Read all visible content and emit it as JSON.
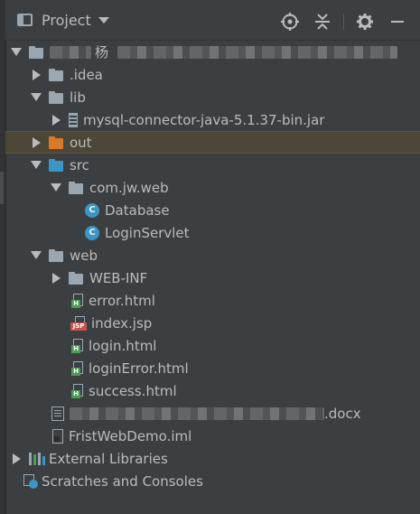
{
  "panel": {
    "title": "Project",
    "tools": [
      "locate-icon",
      "collapse-all-icon",
      "settings-icon",
      "hide-icon"
    ]
  },
  "colors": {
    "background": "#3c3f41",
    "selected_row": "#4b4636",
    "folder_grey": "#9aa7b0",
    "folder_blue": "#3b96c5",
    "folder_orange": "#d97a2b",
    "html_badge": "#499c54",
    "jsp_badge": "#c75450"
  },
  "tree": {
    "root_suffix": "杨",
    "idea": ".idea",
    "lib": "lib",
    "jar": "mysql-connector-java-5.1.37-bin.jar",
    "out": "out",
    "src": "src",
    "package": "com.jw.web",
    "class_database": "Database",
    "class_badge": "C",
    "class_loginservlet": "LoginServlet",
    "web": "web",
    "webinf": "WEB-INF",
    "error_html": "error.html",
    "index_jsp": "index.jsp",
    "jsp_badge": "JSP",
    "html_badge": "H",
    "login_html": "login.html",
    "loginerror_html": "loginError.html",
    "success_html": "success.html",
    "docx_suffix": ".docx",
    "iml": "FristWebDemo.iml",
    "external_libraries": "External Libraries",
    "scratches": "Scratches and Consoles"
  }
}
